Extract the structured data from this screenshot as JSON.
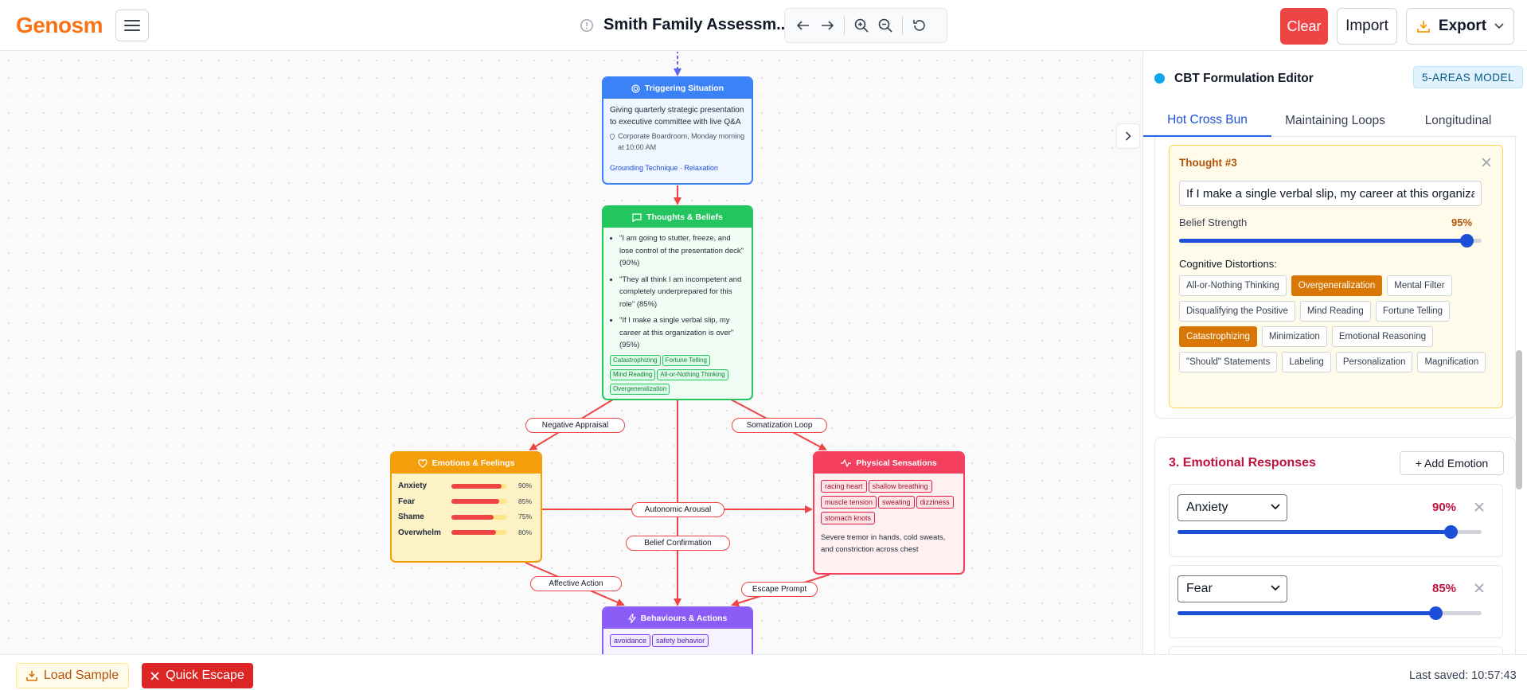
{
  "app": {
    "logo": "Genosm"
  },
  "header": {
    "title": "Smith Family Assessm...",
    "clear_label": "Clear",
    "import_label": "Import",
    "export_label": "Export"
  },
  "nodes": {
    "trigger": {
      "title": "Triggering Situation",
      "description": "Giving quarterly strategic presentation to executive committee with live Q&A",
      "location": "Corporate Boardroom, Monday morning at 10:00 AM",
      "techniques": "Grounding Technique · Relaxation"
    },
    "thoughts": {
      "title": "Thoughts & Beliefs",
      "items": [
        {
          "text": "\"I am going to stutter, freeze, and lose control of the presentation deck\"",
          "pct": "(90%)"
        },
        {
          "text": "\"They all think I am incompetent and completely underprepared for this role\"",
          "pct": "(85%)"
        },
        {
          "text": "\"If I make a single verbal slip, my career at this organization is over\"",
          "pct": "(95%)"
        }
      ],
      "distortions": [
        "Catastrophizing",
        "Fortune Telling",
        "Mind Reading",
        "All-or-Nothing Thinking",
        "Overgeneralization"
      ]
    },
    "emotions": {
      "title": "Emotions & Feelings",
      "items": [
        {
          "name": "Anxiety",
          "value": 90,
          "pct": "90%"
        },
        {
          "name": "Fear",
          "value": 85,
          "pct": "85%"
        },
        {
          "name": "Shame",
          "value": 75,
          "pct": "75%"
        },
        {
          "name": "Overwhelm",
          "value": 80,
          "pct": "80%"
        }
      ]
    },
    "physical": {
      "title": "Physical Sensations",
      "tags": [
        "racing heart",
        "shallow breathing",
        "muscle tension",
        "sweating",
        "dizziness",
        "stomach knots"
      ],
      "description": "Severe tremor in hands, cold sweats, and constriction across chest"
    },
    "behaviours": {
      "title": "Behaviours & Actions",
      "tags": [
        "avoidance",
        "safety behavior"
      ]
    }
  },
  "edges": {
    "negative_appraisal": "Negative Appraisal",
    "somatization_loop": "Somatization Loop",
    "autonomic_arousal": "Autonomic Arousal",
    "belief_confirmation": "Belief Confirmation",
    "affective_action": "Affective Action",
    "escape_prompt": "Escape Prompt"
  },
  "panel": {
    "title": "CBT Formulation Editor",
    "badge": "5-AREAS MODEL",
    "tabs": [
      "Hot Cross Bun",
      "Maintaining Loops",
      "Longitudinal"
    ],
    "thought_card": {
      "label": "Thought #3",
      "value": "If I make a single verbal slip, my career at this organization is over",
      "belief_label": "Belief Strength",
      "belief_pct": "95%",
      "belief_value": 95,
      "distortions_label": "Cognitive Distortions:",
      "distortions": [
        {
          "label": "All-or-Nothing Thinking",
          "on": false
        },
        {
          "label": "Overgeneralization",
          "on": true
        },
        {
          "label": "Mental Filter",
          "on": false
        },
        {
          "label": "Disqualifying the Positive",
          "on": false
        },
        {
          "label": "Mind Reading",
          "on": false
        },
        {
          "label": "Fortune Telling",
          "on": false
        },
        {
          "label": "Catastrophizing",
          "on": true
        },
        {
          "label": "Minimization",
          "on": false
        },
        {
          "label": "Emotional Reasoning",
          "on": false
        },
        {
          "label": "\"Should\" Statements",
          "on": false
        },
        {
          "label": "Labeling",
          "on": false
        },
        {
          "label": "Personalization",
          "on": false
        },
        {
          "label": "Magnification",
          "on": false
        }
      ]
    },
    "emotional_section": {
      "title": "3. Emotional Responses",
      "add_label": "+ Add Emotion",
      "items": [
        {
          "name": "Anxiety",
          "pct": "90%",
          "value": 90
        },
        {
          "name": "Fear",
          "pct": "85%",
          "value": 85
        }
      ]
    }
  },
  "footer": {
    "load_sample": "Load Sample",
    "quick_escape": "Quick Escape",
    "last_saved": "Last saved: 10:57:43"
  },
  "colors": {
    "brand": "#f97316",
    "danger": "#ef4444",
    "accent_blue": "#1d4ed8",
    "amber": "#d97706"
  }
}
